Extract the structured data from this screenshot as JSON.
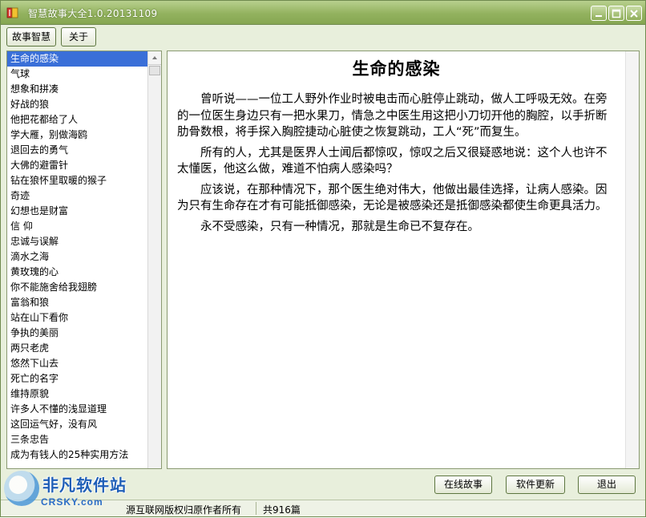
{
  "window": {
    "title": "智慧故事大全1.0.20131109"
  },
  "toolbar": {
    "story_label": "故事智慧",
    "about_label": "关于"
  },
  "list": {
    "items": [
      "生命的感染",
      "气球",
      "想象和拼凑",
      "好战的狼",
      "他把花都给了人",
      "学大雁，别做海鸥",
      "退回去的勇气",
      "大佛的避雷针",
      "钻在狼怀里取暖的猴子",
      "奇迹",
      "幻想也是财富",
      "信 仰",
      "忠诚与误解",
      "滴水之海",
      "黄玫瑰的心",
      "你不能施舍给我翅膀",
      "富翁和狼",
      "站在山下看你",
      "争执的美丽",
      "两只老虎",
      "悠然下山去",
      "死亡的名字",
      "维持原貌",
      "许多人不懂的浅显道理",
      "这回运气好，没有风",
      "三条忠告",
      "成为有钱人的25种实用方法"
    ],
    "selected_index": 0
  },
  "story": {
    "title": "生命的感染",
    "paragraphs": [
      "曾听说——一位工人野外作业时被电击而心脏停止跳动，做人工呼吸无效。在旁的一位医生身边只有一把水果刀，情急之中医生用这把小刀切开他的胸腔，以手折断肋骨数根，将手探入胸腔捷动心脏使之恢复跳动，工人“死”而复生。",
      "所有的人，尤其是医界人士闻后都惊叹，惊叹之后又很疑惑地说：这个人也许不太懂医，他这么做，难道不怕病人感染吗？",
      "应该说，在那种情况下，那个医生绝对伟大，他做出最佳选择，让病人感染。因为只有生命存在才有可能抵御感染，无论是被感染还是抵御感染都使生命更具活力。",
      "永不受感染，只有一种情况，那就是生命已不复存在。"
    ]
  },
  "buttons": {
    "online_label": "在线故事",
    "update_label": "软件更新",
    "exit_label": "退出"
  },
  "status": {
    "copyright": "源互联网版权归原作者所有",
    "count": "共916篇"
  },
  "watermark": {
    "brand": "非凡软件站",
    "domain": "CRSKY.com"
  },
  "colors": {
    "titlebar": "#93b25f",
    "window_bg": "#e8efdc",
    "selection": "#3a6fd8",
    "watermark": "#1f5fb7"
  }
}
